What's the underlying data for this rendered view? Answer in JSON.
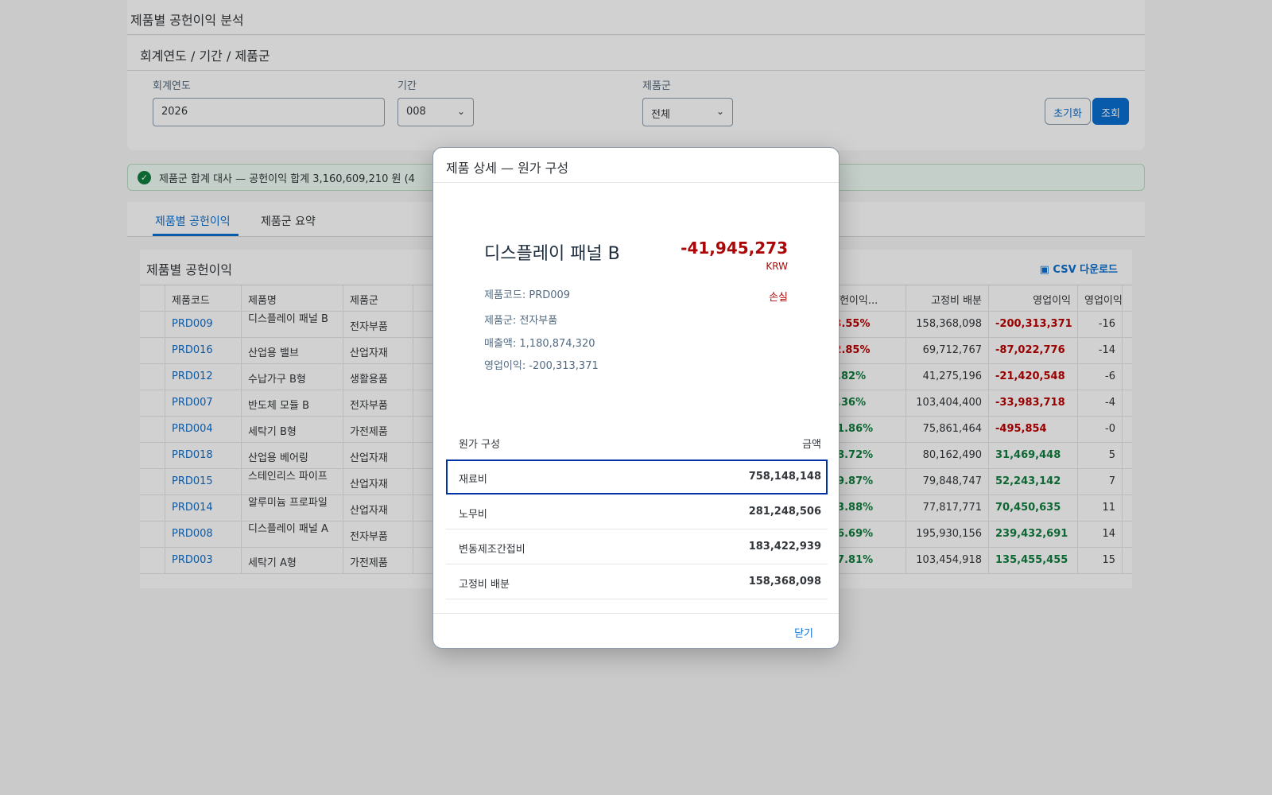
{
  "page_title": "제품별 공헌이익 분석",
  "filter": {
    "header": "회계연도 / 기간 / 제품군",
    "fiscal_year_label": "회계연도",
    "fiscal_year_value": "2026",
    "period_label": "기간",
    "period_value": "008",
    "group_label": "제품군",
    "group_value": "전체",
    "reset_label": "초기화",
    "search_label": "조회"
  },
  "strip": {
    "text": "제품군 합계 대사 — 공헌이익 합계 3,160,609,210 원 (4"
  },
  "tabs": {
    "t1": "제품별 공헌이익",
    "t2": "제품군 요약"
  },
  "table": {
    "title": "제품별 공헌이익",
    "csv_label": "CSV 다운로드",
    "headers": {
      "code": "제품코드",
      "name": "제품명",
      "group": "제품군",
      "cm_rate": "공헌이익...",
      "fixed": "고정비 배분",
      "op": "영업이익",
      "op_rate": "영업이익"
    },
    "rows": [
      {
        "code": "PRD009",
        "name": "디스플레이 패널 B",
        "group": "전자부품",
        "cm_rate": "-3.55%",
        "fixed": "158,368,098",
        "op": "-200,313,371",
        "op_rate": "-16"
      },
      {
        "code": "PRD016",
        "name": "산업용 밸브",
        "group": "산업자재",
        "cm_rate": "-2.85%",
        "fixed": "69,712,767",
        "op": "-87,022,776",
        "op_rate": "-14"
      },
      {
        "code": "PRD012",
        "name": "수납가구 B형",
        "group": "생활용품",
        "cm_rate": "1.82%",
        "fixed": "41,275,196",
        "op": "-21,420,548",
        "op_rate": "-6"
      },
      {
        "code": "PRD007",
        "name": "반도체 모듈 B",
        "group": "전자부품",
        "cm_rate": "1.36%",
        "fixed": "103,404,400",
        "op": "-33,983,718",
        "op_rate": "-4"
      },
      {
        "code": "PRD004",
        "name": "세탁기 B형",
        "group": "가전제품",
        "cm_rate": "11.86%",
        "fixed": "75,861,464",
        "op": "-495,854",
        "op_rate": "-0"
      },
      {
        "code": "PRD018",
        "name": "산업용 베어링",
        "group": "산업자재",
        "cm_rate": "18.72%",
        "fixed": "80,162,490",
        "op": "31,469,448",
        "op_rate": "5"
      },
      {
        "code": "PRD015",
        "name": "스테인리스 파이프",
        "group": "산업자재",
        "cm_rate": "19.87%",
        "fixed": "79,848,747",
        "op": "52,243,142",
        "op_rate": "7"
      },
      {
        "code": "PRD014",
        "name": "알루미늄 프로파일",
        "group": "산업자재",
        "cm_rate": "23.88%",
        "fixed": "77,817,771",
        "op": "70,450,635",
        "op_rate": "11"
      },
      {
        "code": "PRD008",
        "name": "디스플레이 패널 A",
        "group": "전자부품",
        "cm_rate": "26.69%",
        "fixed": "195,930,156",
        "op": "239,432,691",
        "op_rate": "14"
      },
      {
        "code": "PRD003",
        "name": "세탁기 A형",
        "group": "가전제품",
        "cm_rate": "27.81%",
        "fixed": "103,454,918",
        "op": "135,455,455",
        "op_rate": "15"
      }
    ]
  },
  "dialog": {
    "title": "제품 상세 — 원가 구성",
    "product_name": "디스플레이 패널 B",
    "number": "-41,945,273",
    "unit": "KRW",
    "state": "손실",
    "attr_code": "제품코드: PRD009",
    "attr_group": "제품군: 전자부품",
    "attr_sales": "매출액: 1,180,874,320",
    "attr_op": "영업이익: -200,313,371",
    "cost_header_label": "원가 구성",
    "cost_header_amount": "금액",
    "costs": [
      {
        "label": "재료비",
        "amount": "758,148,148"
      },
      {
        "label": "노무비",
        "amount": "281,248,506"
      },
      {
        "label": "변동제조간접비",
        "amount": "183,422,939"
      },
      {
        "label": "고정비 배분",
        "amount": "158,368,098"
      }
    ],
    "close_label": "닫기"
  }
}
